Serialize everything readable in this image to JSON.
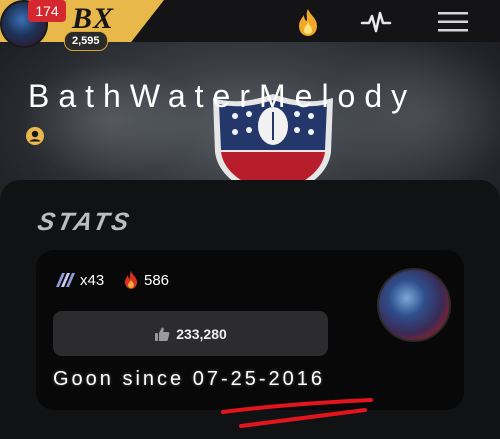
{
  "header": {
    "notification_count": "174",
    "brand": "BX",
    "points": "2,595",
    "icons": [
      "fire-icon",
      "activity-icon",
      "menu-icon"
    ]
  },
  "profile": {
    "username": "BathWaterMelody"
  },
  "stats": {
    "title": "STATS",
    "multiplier": "x43",
    "fire_count": "586",
    "likes": "233,280",
    "since": "Goon since 07-25-2016"
  },
  "colors": {
    "accent": "#e9b84a",
    "badge_red": "#d4272e",
    "annotation_red": "#e3141c"
  }
}
